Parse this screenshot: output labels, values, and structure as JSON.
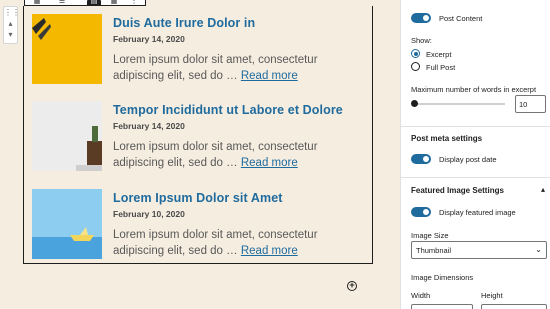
{
  "editor": {
    "appender_symbol": "+",
    "posts": [
      {
        "title": "Duis Aute Irure Dolor in",
        "date": "February 14, 2020",
        "excerpt": "Lorem ipsum dolor sit amet, consectetur adipiscing elit, sed do …",
        "read_more": "Read more",
        "thumb_color": "#f5b800"
      },
      {
        "title": "Tempor Incididunt ut Labore et Dolore",
        "date": "February 14, 2020",
        "excerpt": "Lorem ipsum dolor sit amet, consectetur adipiscing elit, sed do …",
        "read_more": "Read more",
        "thumb_color": "#ececec"
      },
      {
        "title": "Lorem Ipsum Dolor sit Amet",
        "date": "February 10, 2020",
        "excerpt": "Lorem ipsum dolor sit amet, consectetur adipiscing elit, sed do …",
        "read_more": "Read more",
        "thumb_color": "#6cb8e6"
      }
    ]
  },
  "sidebar": {
    "post_content_panel": {
      "toggle_label": "Post Content",
      "show_label": "Show:",
      "options": [
        "Excerpt",
        "Full Post"
      ],
      "selected": "Excerpt",
      "words_label": "Maximum number of words in excerpt",
      "words_value": "10"
    },
    "post_meta_panel": {
      "heading": "Post meta settings",
      "toggle_label": "Display post date"
    },
    "featured_image_panel": {
      "heading": "Featured Image Settings",
      "toggle_label": "Display featured image",
      "size_label": "Image Size",
      "size_value": "Thumbnail",
      "dimensions_label": "Image Dimensions",
      "width_label": "Width",
      "height_label": "Height"
    }
  },
  "colors": {
    "accent": "#1f6b9e",
    "canvas_bg": "#f5ede0"
  }
}
